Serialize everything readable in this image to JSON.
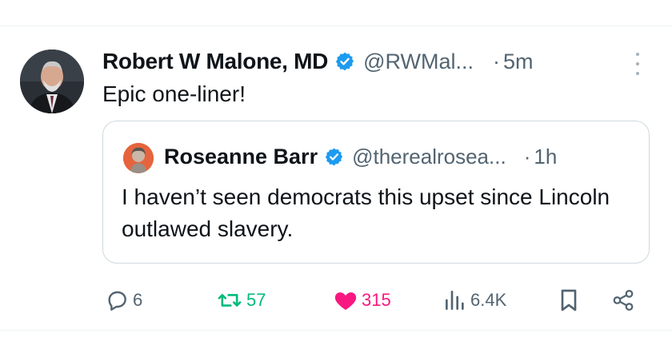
{
  "post": {
    "author": {
      "name": "Robert W Malone, MD",
      "handle": "@RWMal...",
      "separator": "·",
      "time": "5m",
      "verified_color": "#1d9bf0"
    },
    "text": "Epic one-liner!",
    "quoted": {
      "author": {
        "name": "Roseanne Barr",
        "handle": "@therealrosea...",
        "separator": "·",
        "time": "1h"
      },
      "text": "I haven’t seen democrats this upset since Lincoln outlawed slavery."
    },
    "actions": {
      "replies": "6",
      "reposts": "57",
      "likes": "315",
      "views": "6.4K"
    },
    "colors": {
      "repost": "#00ba7c",
      "like": "#f91880",
      "icon": "#536471"
    },
    "icons": [
      "reply-icon",
      "repost-icon",
      "like-icon",
      "views-icon",
      "bookmark-icon",
      "share-icon",
      "more-icon",
      "verified-badge-icon"
    ]
  }
}
